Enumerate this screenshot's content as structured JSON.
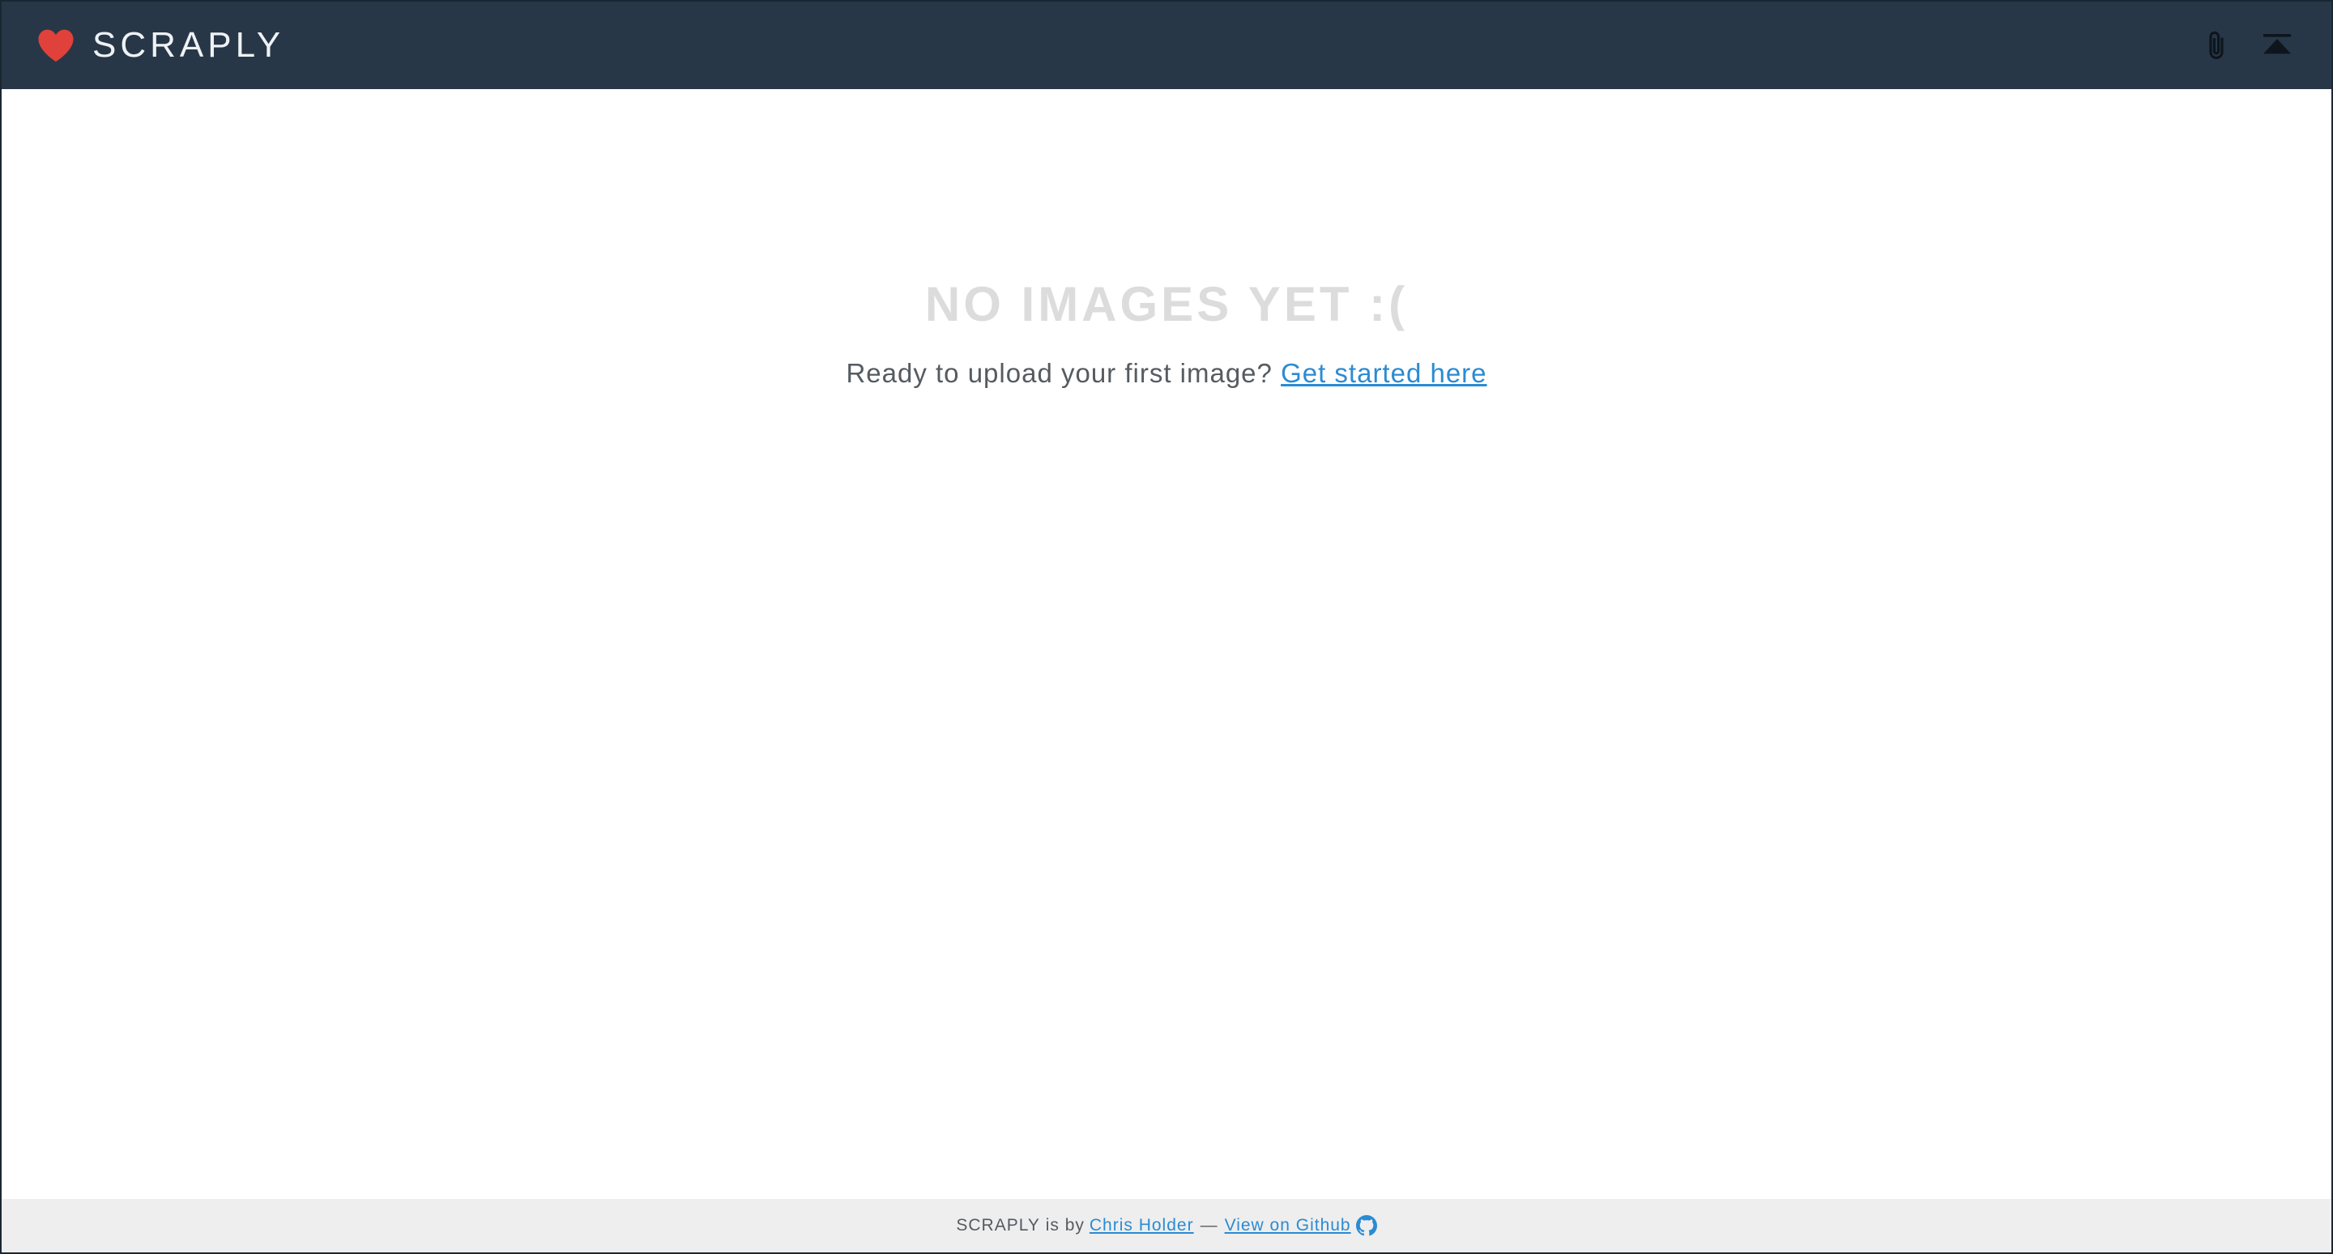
{
  "header": {
    "brand_name": "SCRAPLY",
    "brand_icon": "heart-icon",
    "actions": [
      {
        "icon": "paperclip-icon"
      },
      {
        "icon": "eject-icon"
      }
    ]
  },
  "main": {
    "empty_title": "NO IMAGES YET :(",
    "empty_prompt": "Ready to upload your first image?",
    "cta_link": "Get started here"
  },
  "footer": {
    "brand": "SCRAPLY",
    "is_by": "is by",
    "author_link": "Chris Holder",
    "separator": "—",
    "github_link": "View on Github",
    "github_icon": "github-icon"
  },
  "colors": {
    "navbar": "#283747",
    "heart": "#e0413a",
    "link": "#2b8bd2",
    "empty_title": "#dcdcdc",
    "footer_bg": "#eeeeee"
  }
}
